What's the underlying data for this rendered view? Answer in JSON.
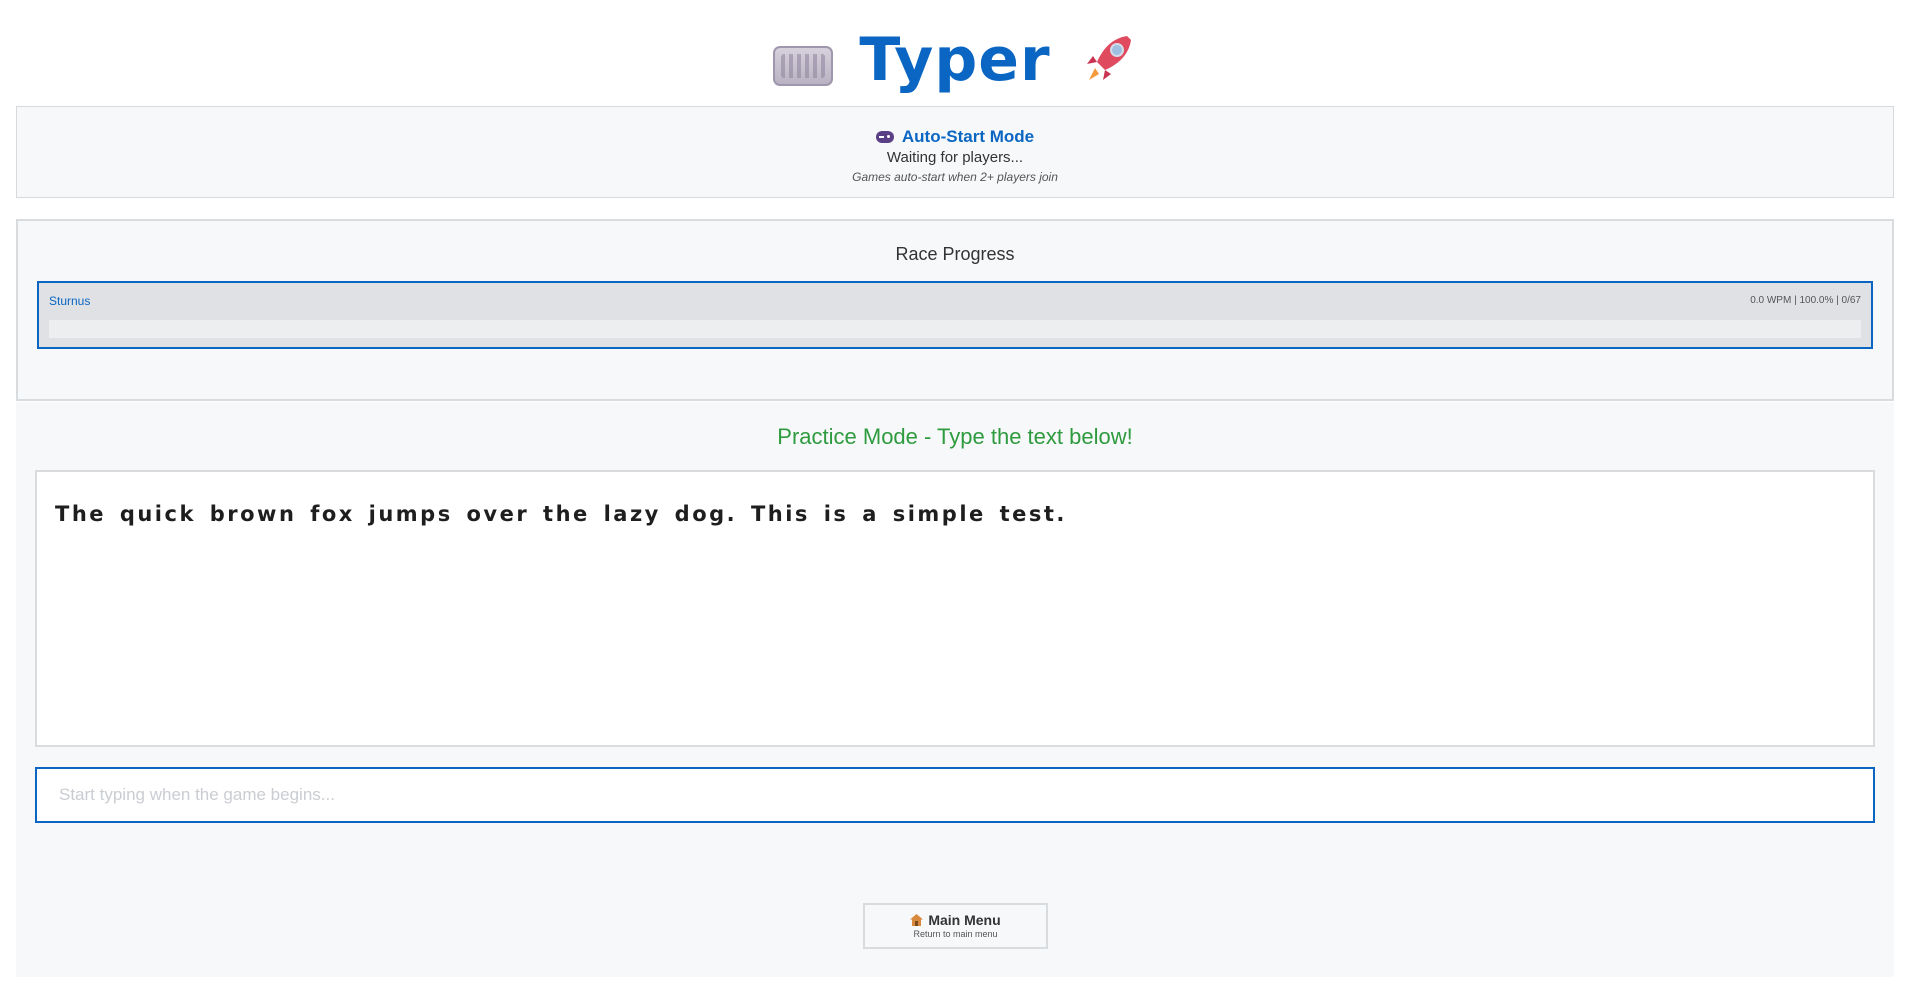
{
  "header": {
    "title": "Typer",
    "left_icon": "keyboard-icon",
    "right_icon": "rocket-icon"
  },
  "status": {
    "icon": "gamepad-icon",
    "title": "Auto-Start Mode",
    "message": "Waiting for players...",
    "note": "Games auto-start when 2+ players join"
  },
  "race": {
    "title": "Race Progress",
    "players": [
      {
        "name": "Sturnus",
        "stats": "0.0 WPM | 100.0% | 0/67",
        "progress": 0
      }
    ]
  },
  "main": {
    "mode_title": "Practice Mode - Type the text below!",
    "passage": "The quick brown fox jumps over the lazy dog. This is a simple test.",
    "input_placeholder": "Start typing when the game begins...",
    "input_value": ""
  },
  "menu_button": {
    "icon": "house-icon",
    "label": "Main Menu",
    "sublabel": "Return to main menu"
  },
  "colors": {
    "accent": "#0a66c2",
    "success": "#2e9b3f",
    "panel_bg": "#f7f8fa"
  }
}
